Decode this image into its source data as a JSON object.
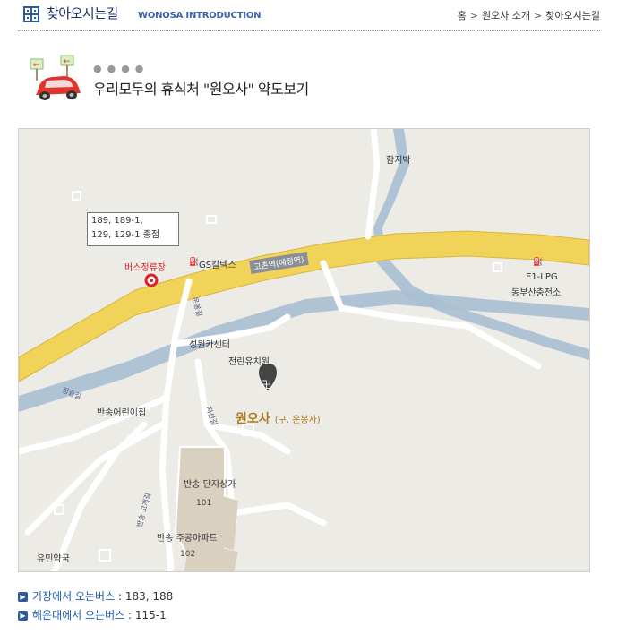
{
  "header": {
    "title": "찾아오시는길",
    "subtitle": "WONOSA INTRODUCTION",
    "breadcrumb": [
      "홈",
      "원오사 소개",
      "찾아오시는길"
    ]
  },
  "section": {
    "title": "우리모두의 휴식처 \"원오사\" 약도보기"
  },
  "map": {
    "callout_lines": [
      "189, 189-1,",
      "129, 129-1 종점"
    ],
    "bus_stop": "버스정류장",
    "places": {
      "gs": "GS칼텍스",
      "hamjibak": "함지박",
      "e1_line1": "E1-LPG",
      "e1_line2": "동부산충전소",
      "seongwon": "성원카센터",
      "jeonrin": "전린유치원",
      "bansong_daycare": "반송어린이집",
      "wonosa": "원오사",
      "wonosa_old": "(구. 운봉사)",
      "market": "반송 단지상가",
      "apartment": "반송 주공아파트",
      "pharmacy": "유민약국",
      "bldg_101": "101",
      "bldg_102": "102"
    },
    "roads": {
      "main": "고촌역(예정역)",
      "unbong": "운봉길",
      "jangseung": "장승길",
      "jisan": "지산길",
      "bansong_gogaegil": "반송 고개길"
    }
  },
  "bus_info": [
    {
      "label": "기장에서 오는버스",
      "value": " : 183, 188"
    },
    {
      "label": "해운대에서 오는버스",
      "value": " : 115-1"
    }
  ],
  "colors": {
    "road_main": "#f2d35a",
    "road_side": "#ffffff",
    "river": "#a9bfd1",
    "bus_stop_red": "#d8222a",
    "wonosa_brown": "#b07a1a",
    "header_blue": "#1f2f6b"
  }
}
